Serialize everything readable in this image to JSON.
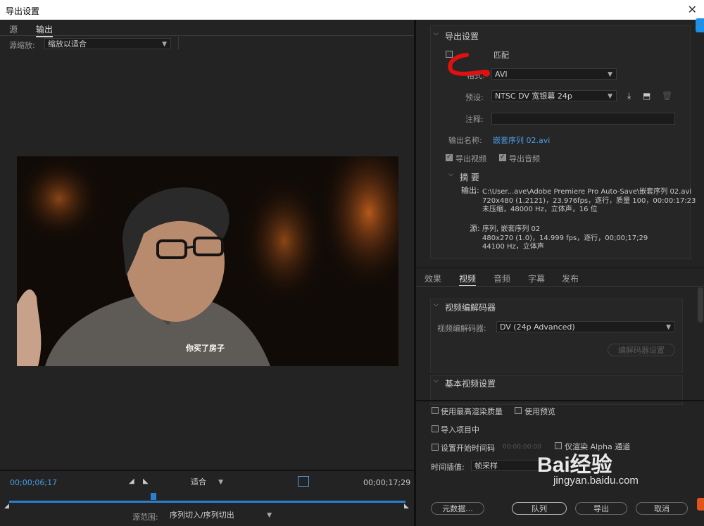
{
  "window": {
    "title": "导出设置"
  },
  "left": {
    "tabs": [
      {
        "label": "源"
      },
      {
        "label": "输出"
      }
    ],
    "source_scale_label": "源缩放:",
    "source_scale_value": "缩放以适合",
    "subtitle": "你买了房子",
    "timecode_current": "00;00;06;17",
    "timecode_end": "00;00;17;29",
    "fit_value": "适合",
    "range_label": "源范围:",
    "range_value": "序列切入/序列切出"
  },
  "export": {
    "section_title": "导出设置",
    "match_label": "匹配",
    "format_label": "格式:",
    "format_value": "AVI",
    "preset_label": "预设:",
    "preset_value": "NTSC DV 宽银幕 24p",
    "comment_label": "注释:",
    "comment_value": "",
    "output_name_label": "输出名称:",
    "output_name_value": "嵌套序列 02.avi",
    "export_video_label": "导出视频",
    "export_audio_label": "导出音频",
    "summary_title": "摘 要",
    "summary_output_label": "输出:",
    "summary_output_lines": [
      "C:\\User...ave\\Adobe Premiere Pro Auto-Save\\嵌套序列 02.avi",
      "720x480 (1.2121)，23.976fps，逐行，质量 100，00:00:17:23",
      "未压缩，48000 Hz，立体声，16 位"
    ],
    "summary_source_label": "源:",
    "summary_source_lines": [
      "序列, 嵌套序列 02",
      "480x270 (1.0)，14.999 fps，逐行，00;00;17;29",
      "44100 Hz，立体声"
    ]
  },
  "settings_tabs": [
    {
      "label": "效果"
    },
    {
      "label": "视频"
    },
    {
      "label": "音频"
    },
    {
      "label": "字幕"
    },
    {
      "label": "发布"
    }
  ],
  "video": {
    "codec_section_title": "视频编解码器",
    "codec_label": "视频编解码器:",
    "codec_value": "DV (24p Advanced)",
    "codec_settings_button": "编解码器设置",
    "basic_section_title": "基本视频设置"
  },
  "bottom": {
    "max_render_quality": "使用最高渲染质量",
    "use_previews": "使用预览",
    "import_into_project": "导入项目中",
    "set_start_timecode": "设置开始时间码",
    "start_timecode_value": "00:00:00:00",
    "render_alpha_only": "仅渲染 Alpha 通道",
    "time_interpolation_label": "时间插值:",
    "time_interpolation_value": "帧采样",
    "metadata_button": "元数据...",
    "queue_button": "队列",
    "export_button": "导出",
    "cancel_button": "取消"
  },
  "watermark": {
    "brand": "Bai经验",
    "url": "jingyan.baidu.com"
  },
  "colors": {
    "accent": "#4a9ee8",
    "timeline": "#2b7fd0",
    "annotation": "#e01010"
  }
}
